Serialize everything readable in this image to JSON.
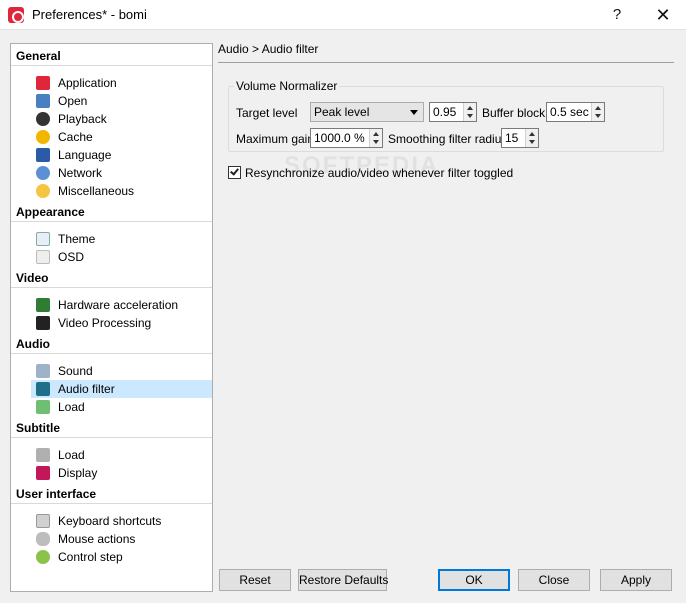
{
  "window": {
    "title": "Preferences* - bomi",
    "help_glyph": "?",
    "close_glyph": "✕"
  },
  "sidebar": {
    "groups": [
      {
        "label": "General",
        "items": [
          {
            "label": "Application",
            "icon": "application-icon"
          },
          {
            "label": "Open",
            "icon": "open-icon"
          },
          {
            "label": "Playback",
            "icon": "playback-icon"
          },
          {
            "label": "Cache",
            "icon": "cache-icon"
          },
          {
            "label": "Language",
            "icon": "language-icon"
          },
          {
            "label": "Network",
            "icon": "network-icon"
          },
          {
            "label": "Miscellaneous",
            "icon": "miscellaneous-icon"
          }
        ]
      },
      {
        "label": "Appearance",
        "items": [
          {
            "label": "Theme",
            "icon": "theme-icon"
          },
          {
            "label": "OSD",
            "icon": "osd-icon"
          }
        ]
      },
      {
        "label": "Video",
        "items": [
          {
            "label": "Hardware acceleration",
            "icon": "hardware-acceleration-icon"
          },
          {
            "label": "Video Processing",
            "icon": "video-processing-icon"
          }
        ]
      },
      {
        "label": "Audio",
        "items": [
          {
            "label": "Sound",
            "icon": "sound-icon"
          },
          {
            "label": "Audio filter",
            "icon": "audio-filter-icon",
            "selected": true
          },
          {
            "label": "Load",
            "icon": "audio-load-icon"
          }
        ]
      },
      {
        "label": "Subtitle",
        "items": [
          {
            "label": "Load",
            "icon": "subtitle-load-icon"
          },
          {
            "label": "Display",
            "icon": "display-icon"
          }
        ]
      },
      {
        "label": "User interface",
        "items": [
          {
            "label": "Keyboard shortcuts",
            "icon": "keyboard-icon"
          },
          {
            "label": "Mouse actions",
            "icon": "mouse-icon"
          },
          {
            "label": "Control step",
            "icon": "control-step-icon"
          }
        ]
      }
    ]
  },
  "content": {
    "breadcrumb": "Audio > Audio filter",
    "volume_normalizer": {
      "legend": "Volume Normalizer",
      "target_level_label": "Target level",
      "target_level_value": "Peak level",
      "target_level_number": "0.95",
      "buffer_block_label": "Buffer block",
      "buffer_block_value": "0.5 sec",
      "maximum_gain_label": "Maximum gain",
      "maximum_gain_value": "1000.0 %",
      "smoothing_label": "Smoothing filter radius",
      "smoothing_value": "15"
    },
    "resync_label": "Resynchronize audio/video whenever filter toggled",
    "resync_checked": true,
    "watermark": "SOFTPEDIA"
  },
  "footer": {
    "reset": "Reset",
    "restore_defaults": "Restore Defaults",
    "ok": "OK",
    "close": "Close",
    "apply": "Apply"
  },
  "colors": {
    "selection": "#cce8ff",
    "accent": "#0078d7",
    "app_icon": "#e0263b"
  }
}
